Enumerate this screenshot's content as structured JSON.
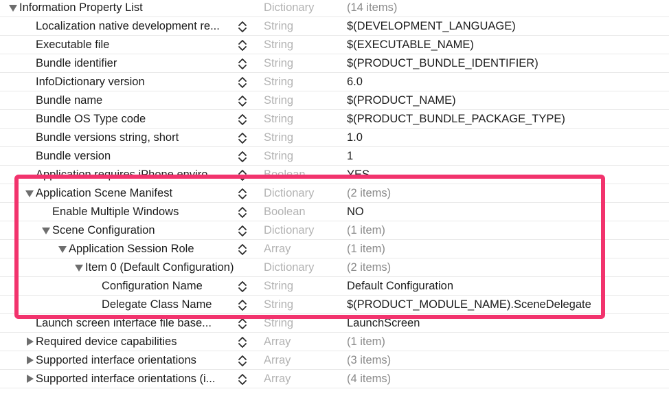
{
  "rows": [
    {
      "key": "Information Property List",
      "type": "Dictionary",
      "value": "(14 items)",
      "disclosure": "down",
      "indent": 0,
      "stepper": false,
      "count": true
    },
    {
      "key": "Localization native development re...",
      "type": "String",
      "value": "$(DEVELOPMENT_LANGUAGE)",
      "disclosure": "none",
      "indent": 1,
      "stepper": true,
      "count": false
    },
    {
      "key": "Executable file",
      "type": "String",
      "value": "$(EXECUTABLE_NAME)",
      "disclosure": "none",
      "indent": 1,
      "stepper": true,
      "count": false
    },
    {
      "key": "Bundle identifier",
      "type": "String",
      "value": "$(PRODUCT_BUNDLE_IDENTIFIER)",
      "disclosure": "none",
      "indent": 1,
      "stepper": true,
      "count": false
    },
    {
      "key": "InfoDictionary version",
      "type": "String",
      "value": "6.0",
      "disclosure": "none",
      "indent": 1,
      "stepper": true,
      "count": false
    },
    {
      "key": "Bundle name",
      "type": "String",
      "value": "$(PRODUCT_NAME)",
      "disclosure": "none",
      "indent": 1,
      "stepper": true,
      "count": false
    },
    {
      "key": "Bundle OS Type code",
      "type": "String",
      "value": "$(PRODUCT_BUNDLE_PACKAGE_TYPE)",
      "disclosure": "none",
      "indent": 1,
      "stepper": true,
      "count": false
    },
    {
      "key": "Bundle versions string, short",
      "type": "String",
      "value": "1.0",
      "disclosure": "none",
      "indent": 1,
      "stepper": true,
      "count": false
    },
    {
      "key": "Bundle version",
      "type": "String",
      "value": "1",
      "disclosure": "none",
      "indent": 1,
      "stepper": true,
      "count": false
    },
    {
      "key": "Application requires iPhone enviro...",
      "type": "Boolean",
      "value": "YES",
      "disclosure": "none",
      "indent": 1,
      "stepper": true,
      "count": false
    },
    {
      "key": "Application Scene Manifest",
      "type": "Dictionary",
      "value": "(2 items)",
      "disclosure": "down",
      "indent": 1,
      "stepper": true,
      "count": true
    },
    {
      "key": "Enable Multiple Windows",
      "type": "Boolean",
      "value": "NO",
      "disclosure": "none",
      "indent": 2,
      "stepper": true,
      "count": false
    },
    {
      "key": "Scene Configuration",
      "type": "Dictionary",
      "value": "(1 item)",
      "disclosure": "down",
      "indent": 2,
      "stepper": true,
      "count": true
    },
    {
      "key": "Application Session Role",
      "type": "Array",
      "value": "(1 item)",
      "disclosure": "down",
      "indent": 3,
      "stepper": true,
      "count": true
    },
    {
      "key": "Item 0 (Default Configuration)",
      "type": "Dictionary",
      "value": "(2 items)",
      "disclosure": "down",
      "indent": 4,
      "stepper": false,
      "count": true
    },
    {
      "key": "Configuration Name",
      "type": "String",
      "value": "Default Configuration",
      "disclosure": "none",
      "indent": 5,
      "stepper": true,
      "count": false
    },
    {
      "key": "Delegate Class Name",
      "type": "String",
      "value": "$(PRODUCT_MODULE_NAME).SceneDelegate",
      "disclosure": "none",
      "indent": 5,
      "stepper": true,
      "count": false
    },
    {
      "key": "Launch screen interface file base...",
      "type": "String",
      "value": "LaunchScreen",
      "disclosure": "none",
      "indent": 1,
      "stepper": true,
      "count": false
    },
    {
      "key": "Required device capabilities",
      "type": "Array",
      "value": "(1 item)",
      "disclosure": "right",
      "indent": 1,
      "stepper": true,
      "count": true
    },
    {
      "key": "Supported interface orientations",
      "type": "Array",
      "value": "(3 items)",
      "disclosure": "right",
      "indent": 1,
      "stepper": true,
      "count": true
    },
    {
      "key": "Supported interface orientations (i...",
      "type": "Array",
      "value": "(4 items)",
      "disclosure": "right",
      "indent": 1,
      "stepper": true,
      "count": true
    }
  ],
  "colors": {
    "highlight": "#f2336d",
    "type_text": "#b3b3b3",
    "count_text": "#8a8a8a",
    "disclosure": "#6e6e6e"
  }
}
